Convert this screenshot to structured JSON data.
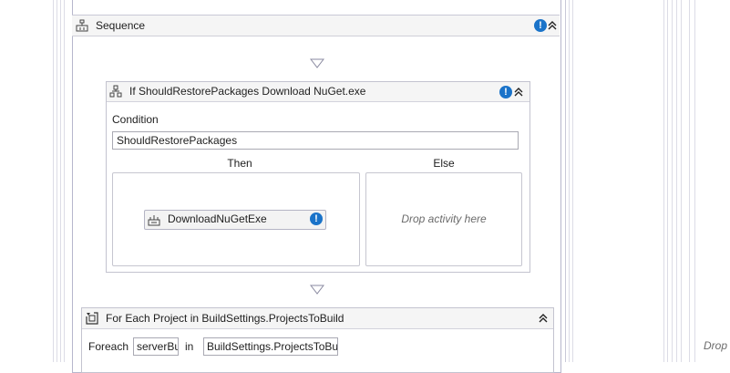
{
  "sequence": {
    "title": "Sequence",
    "warning_glyph": "!"
  },
  "if_activity": {
    "title": "If ShouldRestorePackages Download NuGet.exe",
    "warning_glyph": "!",
    "condition_label": "Condition",
    "condition_value": "ShouldRestorePackages",
    "then_label": "Then",
    "else_label": "Else",
    "then_activity": {
      "label": "DownloadNuGetExe",
      "warning_glyph": "!"
    },
    "else_placeholder": "Drop activity here"
  },
  "foreach_activity": {
    "title": "For Each Project in BuildSettings.ProjectsToBuild",
    "foreach_label": "Foreach",
    "item_value": "serverBu",
    "in_label": "in",
    "collection_value": "BuildSettings.ProjectsToBu"
  },
  "right_panel": {
    "drop_text": "Drop"
  },
  "colors": {
    "accent_blue": "#1a73c9",
    "header_bg": "#f5f5f5",
    "border": "#c3c3cf"
  }
}
